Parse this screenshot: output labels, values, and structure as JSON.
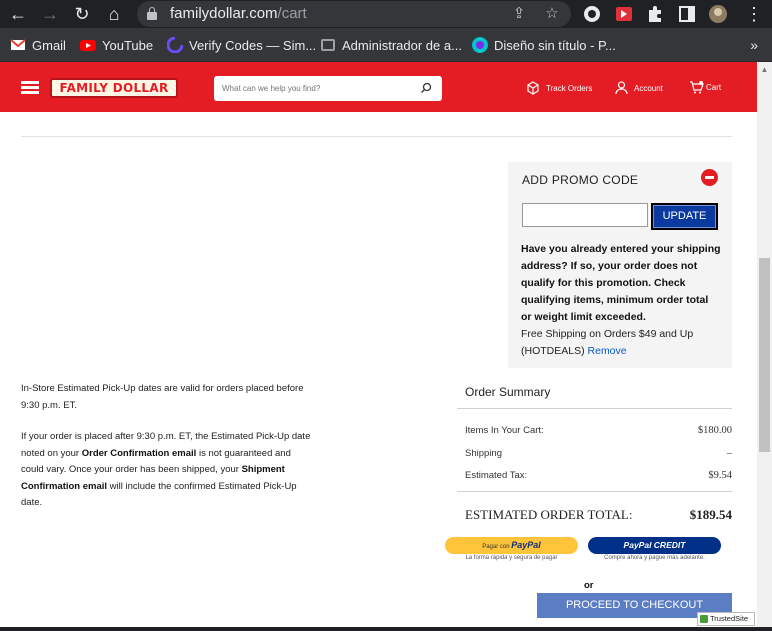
{
  "browser": {
    "url_domain": "familydollar.com",
    "url_path": "/cart",
    "bookmarks": [
      {
        "label": "Gmail",
        "icon": "gmail-icon",
        "color": "#ea4335"
      },
      {
        "label": "YouTube",
        "icon": "youtube-icon",
        "color": "#ff0000"
      },
      {
        "label": "Verify Codes — Sim...",
        "icon": "verify-codes-icon",
        "color": "#6b4cf6"
      },
      {
        "label": "Administrador de a...",
        "icon": "admin-icon",
        "color": "#8ab4f8"
      },
      {
        "label": "Diseño sin título - P...",
        "icon": "canva-icon",
        "color": "#00c4cc"
      }
    ],
    "overflow": "»"
  },
  "header": {
    "logo_text": "FAMILY DOLLAR",
    "search_placeholder": "What can we help you find?",
    "track_orders": "Track Orders",
    "account": "Account",
    "cart": "Cart",
    "brand_color": "#e41d25"
  },
  "promo": {
    "title": "ADD PROMO CODE",
    "input_value": "",
    "update_label": "UPDATE",
    "warning": "Have you already entered your shipping address? If so, your order does not qualify for this promotion. Check qualifying items, minimum order total or weight limit exceeded.",
    "applied_text": "Free Shipping on Orders $49 and Up (HOTDEALS)",
    "remove_label": "Remove"
  },
  "info": {
    "pickup_note": "In-Store Estimated Pick-Up dates are valid for orders placed before 9:30 p.m. ET.",
    "p2_a": "If your order is placed after 9:30 p.m. ET, the Estimated Pick-Up date noted on your ",
    "p2_b": "Order Confirmation email",
    "p2_c": " is not guaranteed and could vary. Once your order has been shipped, your ",
    "p2_d": "Shipment Confirmation email",
    "p2_e": " will include the confirmed Estimated Pick-Up date."
  },
  "summary": {
    "title": "Order Summary",
    "items_label": "Items In Your Cart:",
    "items_value": "$180.00",
    "shipping_label": "Shipping",
    "shipping_value": "–",
    "tax_label": "Estimated Tax:",
    "tax_value": "$9.54",
    "total_label": "ESTIMATED ORDER TOTAL:",
    "total_value": "$189.54",
    "paypal_prefix": "Pagar con",
    "paypal_brand": "PayPal",
    "paypal_sub": "La forma rápida y segura de pagar",
    "paypal_credit": "PayPal CREDIT",
    "paypal_credit_sub": "Compre ahora y pague más adelante.",
    "or": "or",
    "checkout_label": "PROCEED TO CHECKOUT",
    "trusted_label": "TrustedSite"
  }
}
